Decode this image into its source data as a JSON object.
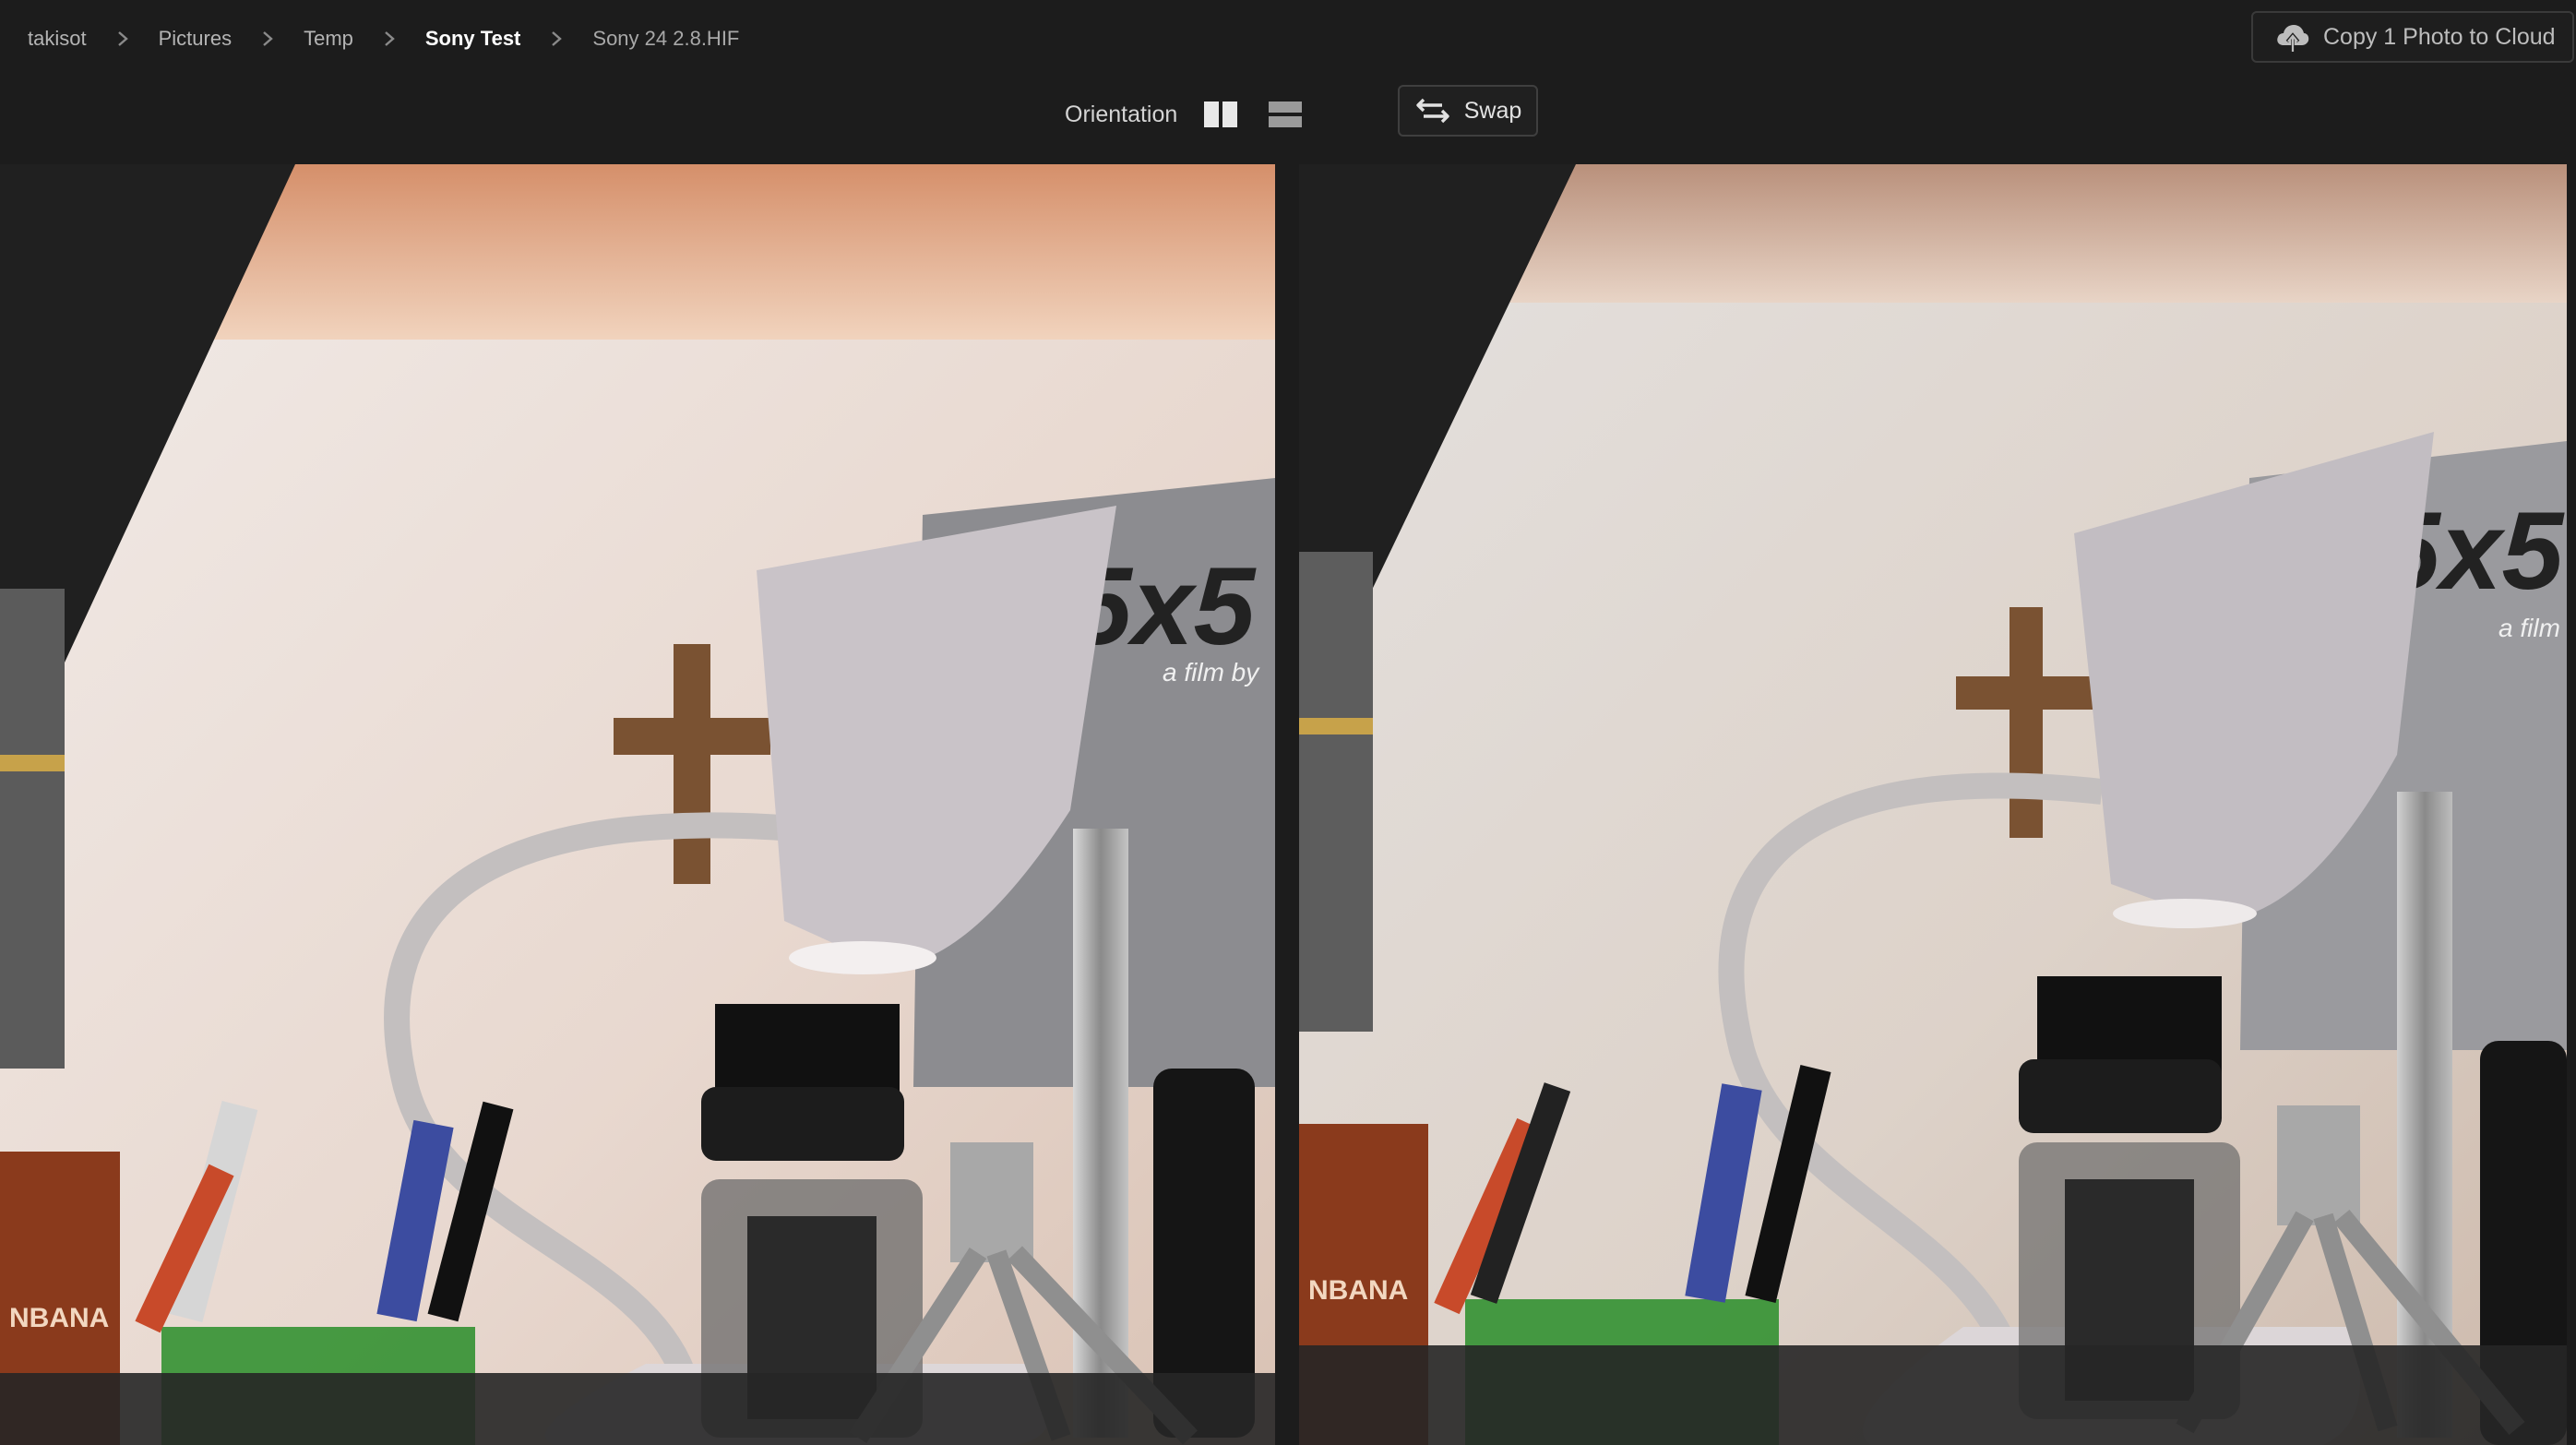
{
  "breadcrumb": {
    "items": [
      "takisot",
      "Pictures",
      "Temp",
      "Sony Test"
    ],
    "file": "Sony 24 2.8.HIF"
  },
  "toolbar": {
    "orientation_label": "Orientation",
    "swap_label": "Swap",
    "copy_label": "Copy 1 Photo to Cloud",
    "icons": [
      "side-by-side-icon",
      "stacked-icon",
      "swap-arrows-icon",
      "cloud-upload-icon"
    ]
  },
  "photos": {
    "left": "Sony Test photo (left, selected)",
    "right": "Sony Test photo (right)"
  },
  "colors": {
    "background": "#1c1c1c",
    "selection_border": "#ffffff",
    "lamp": "#c9c3c8",
    "green_cup": "#2f8f2e"
  }
}
